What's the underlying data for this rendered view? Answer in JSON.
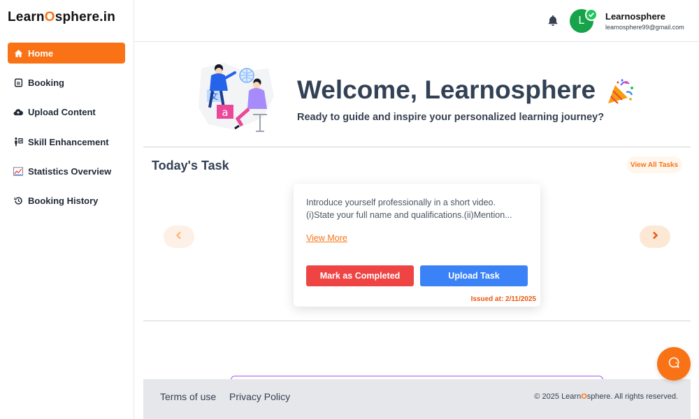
{
  "brand": {
    "prefix": "Learn",
    "o": "O",
    "suffix": "sphere.in"
  },
  "sidebar": {
    "items": [
      {
        "label": "Home",
        "icon": "home-icon",
        "active": true
      },
      {
        "label": "Booking",
        "icon": "booking-icon"
      },
      {
        "label": "Upload Content",
        "icon": "cloud-upload-icon"
      },
      {
        "label": "Skill Enhancement",
        "icon": "skill-icon"
      },
      {
        "label": "Statistics Overview",
        "icon": "chart-icon"
      },
      {
        "label": "Booking History",
        "icon": "history-icon"
      }
    ]
  },
  "header": {
    "avatar_letter": "L",
    "user_name": "Learnosphere",
    "user_email": "learnosphere99@gmail.com"
  },
  "welcome": {
    "title": "Welcome, Learnosphere",
    "subtitle": "Ready to guide and inspire your personalized learning journey?"
  },
  "tasks": {
    "heading": "Today's Task",
    "view_all": "View All Tasks",
    "card": {
      "line1": "Introduce yourself professionally in a short video.",
      "line2": "(i)State your full name and qualifications.(ii)Mention...",
      "view_more": "View More",
      "mark_completed": "Mark as Completed",
      "upload_task": "Upload Task",
      "issued": "Issued at: 2/11/2025"
    }
  },
  "footer": {
    "terms": "Terms of use",
    "privacy": "Privacy Policy",
    "copyright_prefix": "© 2025 Learn",
    "copyright_o": "O",
    "copyright_suffix": "sphere. All rights reserved."
  },
  "colors": {
    "accent": "#f97316",
    "danger": "#ef4444",
    "primary": "#3b82f6",
    "avatar": "#16a34a"
  }
}
